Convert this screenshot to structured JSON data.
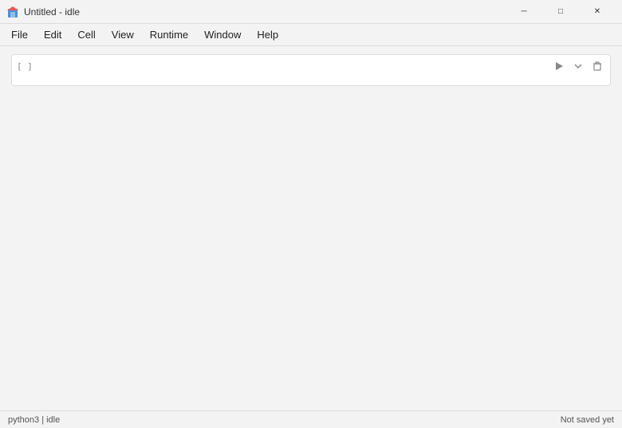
{
  "titlebar": {
    "title": "Untitled - idle",
    "icon_label": "notebook-icon",
    "minimize_label": "─",
    "maximize_label": "□",
    "close_label": "✕"
  },
  "menubar": {
    "items": [
      {
        "label": "File",
        "id": "menu-file"
      },
      {
        "label": "Edit",
        "id": "menu-edit"
      },
      {
        "label": "Cell",
        "id": "menu-cell"
      },
      {
        "label": "View",
        "id": "menu-view"
      },
      {
        "label": "Runtime",
        "id": "menu-runtime"
      },
      {
        "label": "Window",
        "id": "menu-window"
      },
      {
        "label": "Help",
        "id": "menu-help"
      }
    ]
  },
  "notebook": {
    "cells": [
      {
        "index": "[ ]",
        "value": "",
        "placeholder": ""
      }
    ]
  },
  "statusbar": {
    "left": "python3 | idle",
    "right": "Not saved yet"
  }
}
